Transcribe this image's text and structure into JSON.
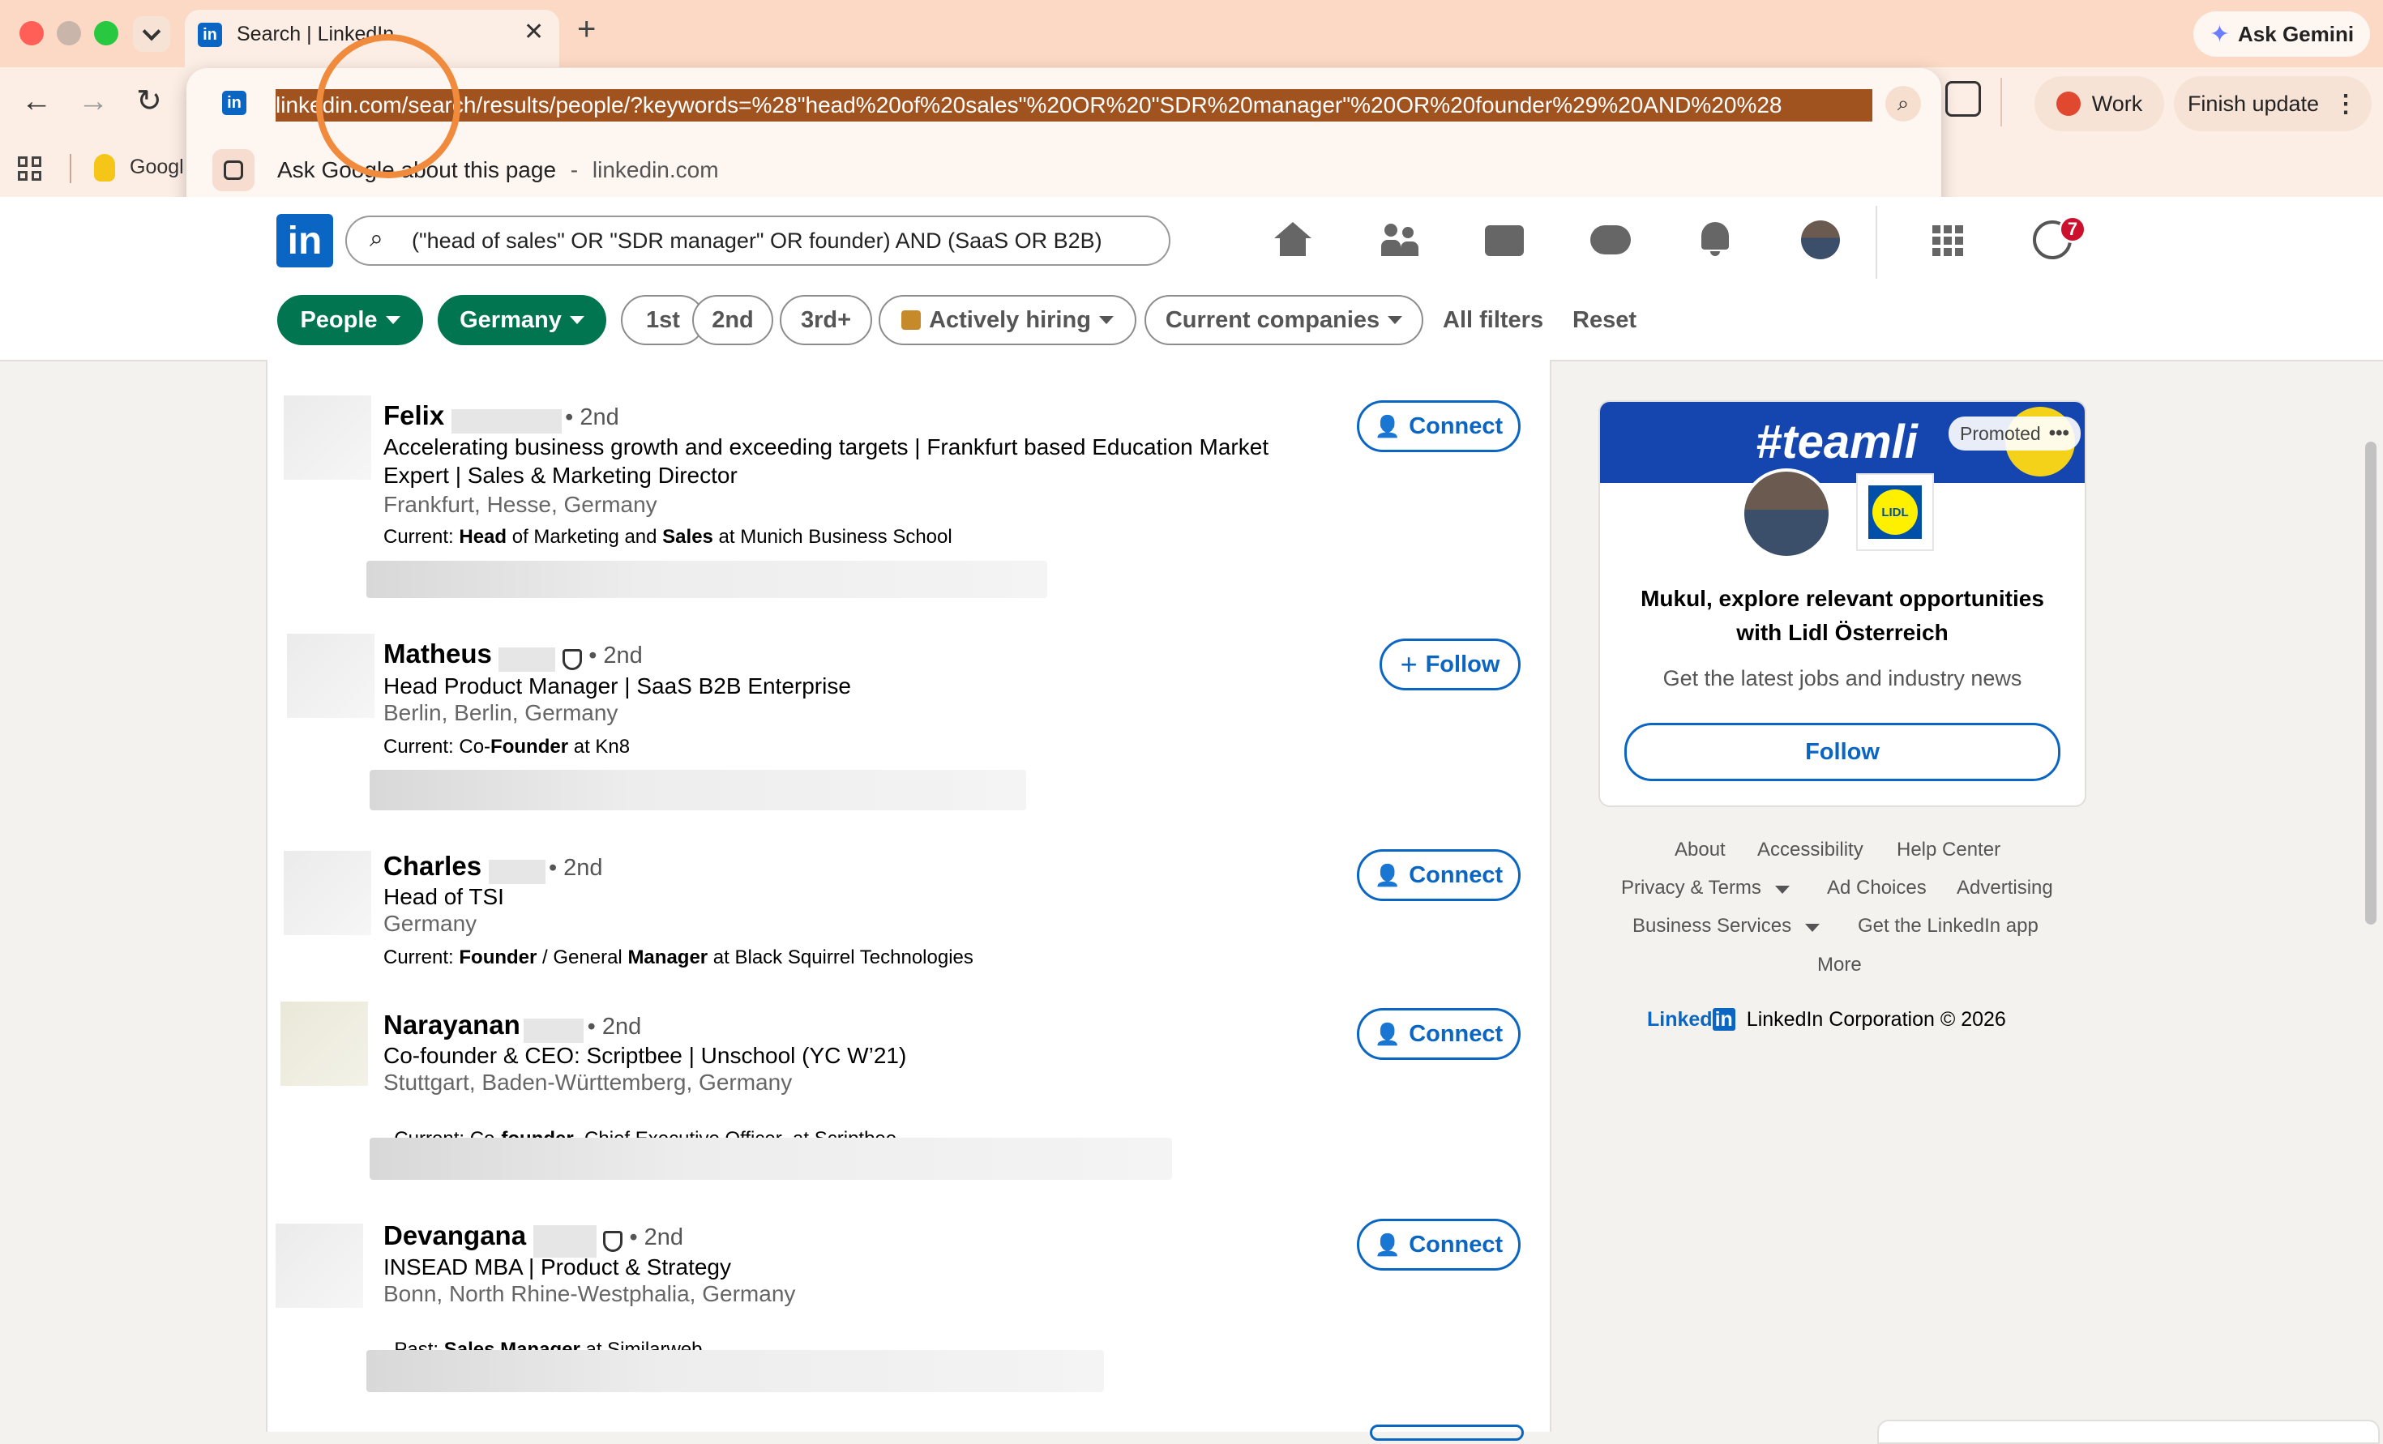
{
  "browser": {
    "tab_title": "Search | LinkedIn",
    "url": "linkedin.com/search/results/people/?keywords=%28\"head%20of%20sales\"%20OR%20\"SDR%20manager\"%20OR%20founder%29%20AND%20%28",
    "ask_gemini": "Ask Gemini",
    "suggestion_text": "Ask Google about this page",
    "suggestion_sep": "-",
    "suggestion_domain": "linkedin.com",
    "bookmark_label": "Googl",
    "profile_label": "Work",
    "finish_update": "Finish update",
    "accent": "#f08a3c"
  },
  "linkedin": {
    "search_query": "(\"head of sales\" OR \"SDR manager\" OR founder) AND (SaaS OR B2B)",
    "notifications_badge": "7",
    "brand_color": "#0a66c2"
  },
  "filters": [
    {
      "label": "People",
      "active": true
    },
    {
      "label": "Germany",
      "active": true
    },
    {
      "label": "1st"
    },
    {
      "label": "2nd"
    },
    {
      "label": "3rd+"
    },
    {
      "label": "Actively hiring"
    },
    {
      "label": "Current companies"
    }
  ],
  "filter_links": {
    "all_filters": "All filters",
    "reset": "Reset"
  },
  "results": [
    {
      "name": "Felix",
      "degree": "• 2nd",
      "headline_1": "Accelerating business growth and exceeding targets | Frankfurt based Education Market",
      "headline_2": "Expert | Sales & Marketing Director",
      "location": "Frankfurt, Hesse, Germany",
      "current_prefix": "Current:",
      "current_b1": "Head",
      "current_m1": " of Marketing and ",
      "current_b2": "Sales",
      "current_m2": " at Munich Business School",
      "action": "Connect"
    },
    {
      "name": "Matheus",
      "degree": "• 2nd",
      "headline_1": "Head Product Manager | SaaS B2B Enterprise",
      "location": "Berlin, Berlin, Germany",
      "current_prefix": "Current:",
      "current_m1": " Co-",
      "current_b1": "Founder",
      "current_m2": " at Kn8",
      "action": "Follow"
    },
    {
      "name": "Charles",
      "degree": "• 2nd",
      "headline_1": "Head of TSI",
      "location": "Germany",
      "current_prefix": "Current:",
      "current_b1": "Founder",
      "current_m1": " / General ",
      "current_b2": "Manager",
      "current_m2": " at Black Squirrel Technologies",
      "action": "Connect"
    },
    {
      "name": "Narayanan",
      "degree": "• 2nd",
      "headline_1": "Co-founder & CEO: Scriptbee | Unschool (YC W’21)",
      "location": "Stuttgart, Baden-Württemberg, Germany",
      "current_prefix": "Current:",
      "current_m1": " Co-",
      "current_b1": "founder",
      "current_m2": ", Chief Executive Officer  at Scriptbee",
      "action": "Connect"
    },
    {
      "name": "Devangana",
      "degree": "• 2nd",
      "headline_1": "INSEAD MBA | Product & Strategy",
      "location": "Bonn, North Rhine-Westphalia, Germany",
      "current_prefix": "Past:",
      "current_b1": "Sales Manager",
      "current_m1": " at Similarweb",
      "action": "Connect"
    }
  ],
  "promo": {
    "banner_text": "#teamli",
    "promoted": "Promoted",
    "logo_text": "LIDL",
    "title_1": "Mukul, explore relevant opportunities",
    "title_2": "with Lidl Österreich",
    "subtitle": "Get the latest jobs and industry news",
    "follow": "Follow"
  },
  "footer": {
    "about": "About",
    "accessibility": "Accessibility",
    "help": "Help Center",
    "privacy": "Privacy & Terms",
    "ad_choices": "Ad Choices",
    "advertising": "Advertising",
    "business": "Business Services",
    "get_app": "Get the LinkedIn app",
    "more": "More",
    "brand_text": "Linked",
    "brand_in": "in",
    "copyright": "LinkedIn Corporation © 2026"
  }
}
